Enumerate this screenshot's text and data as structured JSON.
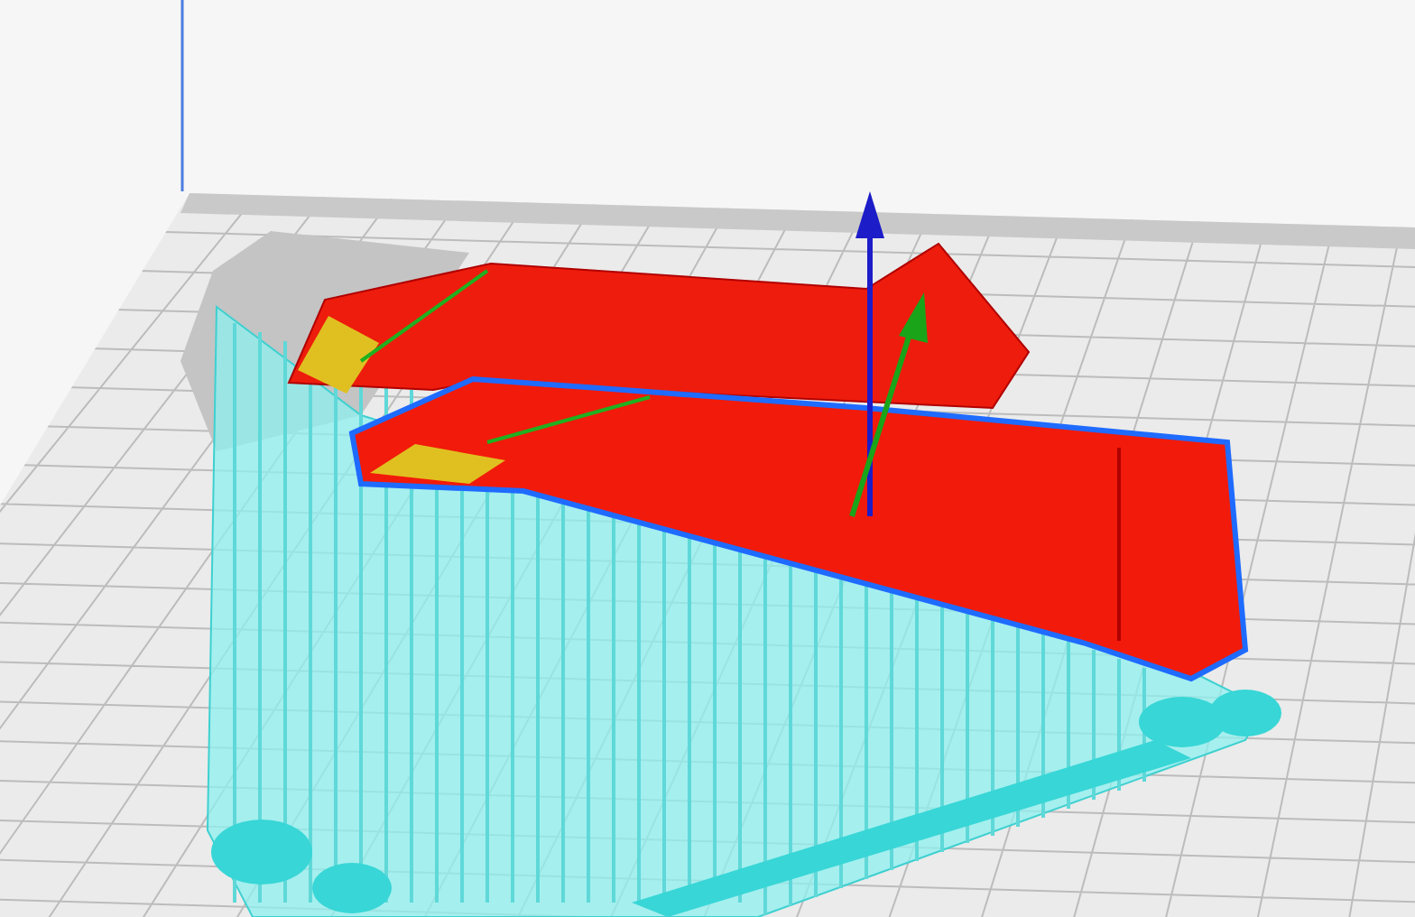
{
  "viewport": {
    "kind": "layer-view"
  }
}
